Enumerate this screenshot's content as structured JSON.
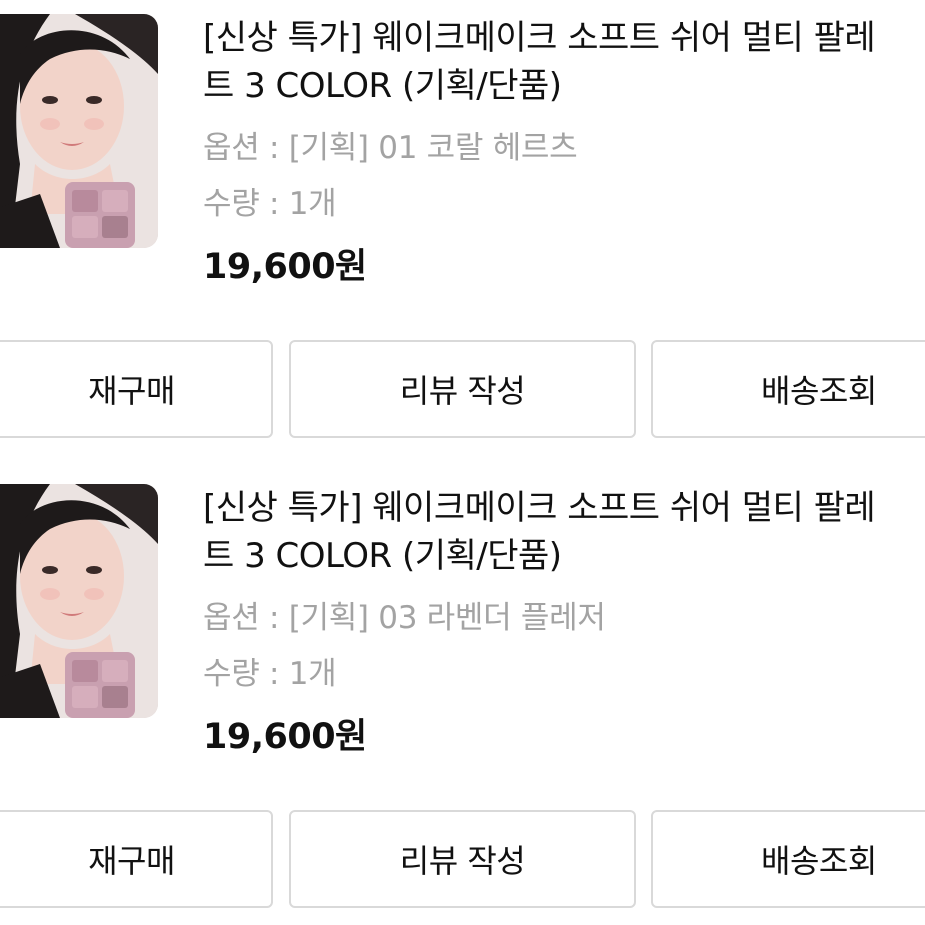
{
  "orders": [
    {
      "product_image": "product-thumbnail",
      "title": "[신상 특가] 웨이크메이크 소프트 쉬어 멀티 팔레트 3 COLOR (기획/단품)",
      "option": "옵션 : [기획] 01 코랄 헤르츠",
      "quantity": "수량 : 1개",
      "price": "19,600원",
      "buttons": {
        "rebuy": "재구매",
        "review": "리뷰 작성",
        "shipping": "배송조회"
      }
    },
    {
      "product_image": "product-thumbnail",
      "title": "[신상 특가] 웨이크메이크 소프트 쉬어 멀티 팔레트 3 COLOR (기획/단품)",
      "option": "옵션 : [기획] 03 라벤더 플레저",
      "quantity": "수량 : 1개",
      "price": "19,600원",
      "buttons": {
        "rebuy": "재구매",
        "review": "리뷰 작성",
        "shipping": "배송조회"
      }
    }
  ],
  "colors": {
    "text_primary": "#111111",
    "text_secondary": "#a3a3a3",
    "button_border": "#d9d9d9",
    "palette_pink": "#c9a0b0"
  }
}
